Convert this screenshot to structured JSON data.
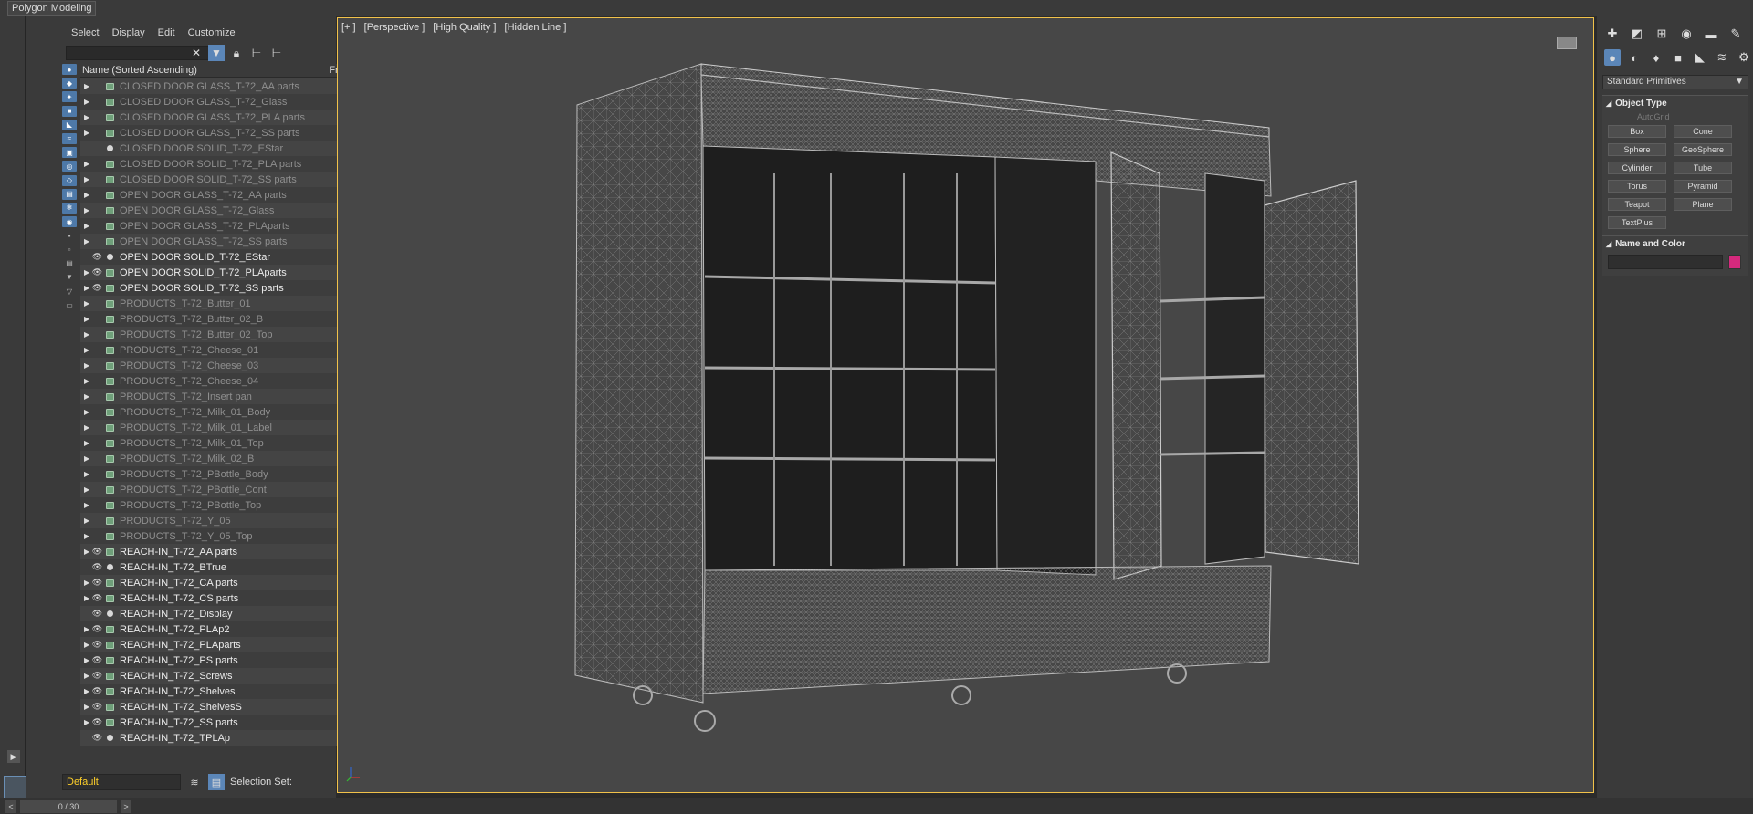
{
  "ribbon": {
    "tab": "Polygon Modeling"
  },
  "explorer": {
    "menu": [
      "Select",
      "Display",
      "Edit",
      "Customize"
    ],
    "header_name": "Name (Sorted Ascending)",
    "header_fro": "Fro...",
    "items": [
      {
        "name": "CLOSED DOOR GLASS_T-72_AA parts",
        "state": "hidden",
        "type": "layer",
        "exp": true
      },
      {
        "name": "CLOSED DOOR GLASS_T-72_Glass",
        "state": "hidden",
        "type": "layer",
        "exp": true
      },
      {
        "name": "CLOSED DOOR GLASS_T-72_PLA parts",
        "state": "hidden",
        "type": "layer",
        "exp": true
      },
      {
        "name": "CLOSED DOOR GLASS_T-72_SS parts",
        "state": "hidden",
        "type": "layer",
        "exp": true
      },
      {
        "name": "CLOSED DOOR SOLID_T-72_EStar",
        "state": "hidden",
        "type": "object",
        "exp": false
      },
      {
        "name": "CLOSED DOOR SOLID_T-72_PLA parts",
        "state": "hidden",
        "type": "layer",
        "exp": true
      },
      {
        "name": "CLOSED DOOR SOLID_T-72_SS parts",
        "state": "hidden",
        "type": "layer",
        "exp": true
      },
      {
        "name": "OPEN DOOR GLASS_T-72_AA parts",
        "state": "hidden",
        "type": "layer",
        "exp": true
      },
      {
        "name": "OPEN DOOR GLASS_T-72_Glass",
        "state": "hidden",
        "type": "layer",
        "exp": true
      },
      {
        "name": "OPEN DOOR GLASS_T-72_PLAparts",
        "state": "hidden",
        "type": "layer",
        "exp": true
      },
      {
        "name": "OPEN DOOR GLASS_T-72_SS parts",
        "state": "hidden",
        "type": "layer",
        "exp": true
      },
      {
        "name": "OPEN DOOR SOLID_T-72_EStar",
        "state": "visible",
        "type": "object",
        "exp": false
      },
      {
        "name": "OPEN DOOR SOLID_T-72_PLAparts",
        "state": "visible",
        "type": "layer",
        "exp": true
      },
      {
        "name": "OPEN DOOR SOLID_T-72_SS parts",
        "state": "visible",
        "type": "layer",
        "exp": true
      },
      {
        "name": "PRODUCTS_T-72_Butter_01",
        "state": "hidden",
        "type": "layer",
        "exp": true
      },
      {
        "name": "PRODUCTS_T-72_Butter_02_B",
        "state": "hidden",
        "type": "layer",
        "exp": true
      },
      {
        "name": "PRODUCTS_T-72_Butter_02_Top",
        "state": "hidden",
        "type": "layer",
        "exp": true
      },
      {
        "name": "PRODUCTS_T-72_Cheese_01",
        "state": "hidden",
        "type": "layer",
        "exp": true
      },
      {
        "name": "PRODUCTS_T-72_Cheese_03",
        "state": "hidden",
        "type": "layer",
        "exp": true
      },
      {
        "name": "PRODUCTS_T-72_Cheese_04",
        "state": "hidden",
        "type": "layer",
        "exp": true
      },
      {
        "name": "PRODUCTS_T-72_Insert pan",
        "state": "hidden",
        "type": "layer",
        "exp": true
      },
      {
        "name": "PRODUCTS_T-72_Milk_01_Body",
        "state": "hidden",
        "type": "layer",
        "exp": true
      },
      {
        "name": "PRODUCTS_T-72_Milk_01_Label",
        "state": "hidden",
        "type": "layer",
        "exp": true
      },
      {
        "name": "PRODUCTS_T-72_Milk_01_Top",
        "state": "hidden",
        "type": "layer",
        "exp": true
      },
      {
        "name": "PRODUCTS_T-72_Milk_02_B",
        "state": "hidden",
        "type": "layer",
        "exp": true
      },
      {
        "name": "PRODUCTS_T-72_PBottle_Body",
        "state": "hidden",
        "type": "layer",
        "exp": true
      },
      {
        "name": "PRODUCTS_T-72_PBottle_Cont",
        "state": "hidden",
        "type": "layer",
        "exp": true
      },
      {
        "name": "PRODUCTS_T-72_PBottle_Top",
        "state": "hidden",
        "type": "layer",
        "exp": true
      },
      {
        "name": "PRODUCTS_T-72_Y_05",
        "state": "hidden",
        "type": "layer",
        "exp": true
      },
      {
        "name": "PRODUCTS_T-72_Y_05_Top",
        "state": "hidden",
        "type": "layer",
        "exp": true
      },
      {
        "name": "REACH-IN_T-72_AA parts",
        "state": "visible",
        "type": "layer",
        "exp": true
      },
      {
        "name": "REACH-IN_T-72_BTrue",
        "state": "visible",
        "type": "object",
        "exp": false
      },
      {
        "name": "REACH-IN_T-72_CA parts",
        "state": "visible",
        "type": "layer",
        "exp": true
      },
      {
        "name": "REACH-IN_T-72_CS parts",
        "state": "visible",
        "type": "layer",
        "exp": true
      },
      {
        "name": "REACH-IN_T-72_Display",
        "state": "visible",
        "type": "object",
        "exp": false
      },
      {
        "name": "REACH-IN_T-72_PLAp2",
        "state": "visible",
        "type": "layer",
        "exp": true
      },
      {
        "name": "REACH-IN_T-72_PLAparts",
        "state": "visible",
        "type": "layer",
        "exp": true
      },
      {
        "name": "REACH-IN_T-72_PS parts",
        "state": "visible",
        "type": "layer",
        "exp": true
      },
      {
        "name": "REACH-IN_T-72_Screws",
        "state": "visible",
        "type": "layer",
        "exp": true
      },
      {
        "name": "REACH-IN_T-72_Shelves",
        "state": "visible",
        "type": "layer",
        "exp": true
      },
      {
        "name": "REACH-IN_T-72_ShelvesS",
        "state": "visible",
        "type": "layer",
        "exp": true
      },
      {
        "name": "REACH-IN_T-72_SS parts",
        "state": "visible",
        "type": "layer",
        "exp": true
      },
      {
        "name": "REACH-IN_T-72_TPLAp",
        "state": "visible",
        "type": "object",
        "exp": false
      }
    ],
    "layer_dropdown": "Default",
    "selection_set_label": "Selection Set:"
  },
  "viewport": {
    "labels": [
      "[+ ]",
      "[Perspective ]",
      "[High Quality ]",
      "[Hidden Line ]"
    ]
  },
  "command_panel": {
    "category": "Standard Primitives",
    "object_type_title": "Object Type",
    "autogrid": "AutoGrid",
    "buttons": [
      "Box",
      "Cone",
      "Sphere",
      "GeoSphere",
      "Cylinder",
      "Tube",
      "Torus",
      "Pyramid",
      "Teapot",
      "Plane",
      "TextPlus"
    ],
    "name_color_title": "Name and Color",
    "color": "#d5297d"
  },
  "timeline": {
    "frame": "0 / 30"
  },
  "colors": {
    "viewport_border": "#f1c24a",
    "accent": "#5b86b8",
    "layer_name": "#ffd02a"
  }
}
